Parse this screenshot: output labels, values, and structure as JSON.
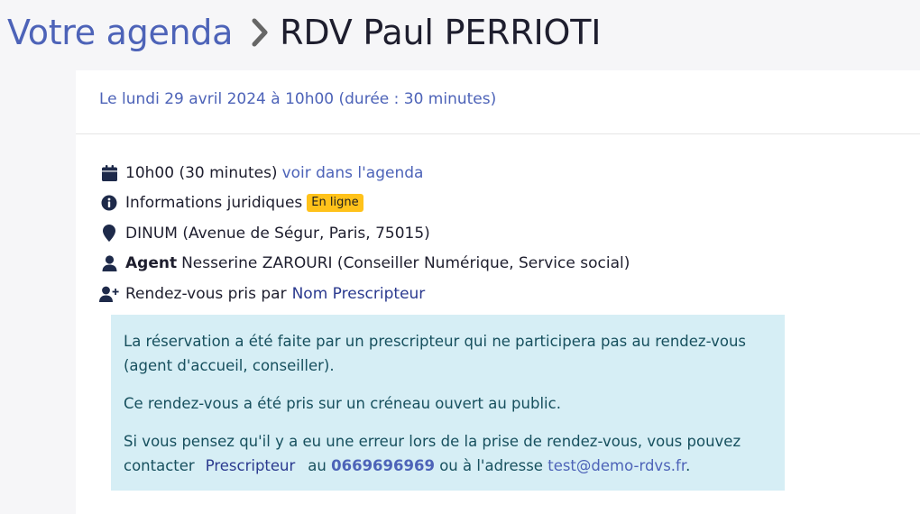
{
  "breadcrumb": {
    "parent_label": "Votre agenda",
    "current_label": "RDV Paul PERRIOTI"
  },
  "appointment": {
    "date_line": "Le lundi 29 avril 2024 à 10h00 (durée : 30 minutes)",
    "time_text": "10h00 (30 minutes)",
    "agenda_link": "voir dans l'agenda",
    "motif": "Informations juridiques",
    "location_badge": "En ligne",
    "place": "DINUM (Avenue de Ségur, Paris, 75015)",
    "agent_label": "Agent",
    "agent_value": "Nesserine ZAROURI (Conseiller Numérique, Service social)",
    "created_by_label": "Rendez-vous pris par",
    "created_by_link": "Nom Prescripteur"
  },
  "alert": {
    "line1": "La réservation a été faite par un prescripteur qui ne participera pas au rendez-vous",
    "line1b": "(agent d'accueil, conseiller).",
    "line2": "Ce rendez-vous a été pris sur un créneau ouvert au public.",
    "line3a": "Si vous pensez qu'il y a eu une erreur lors de la prise de rendez-vous, vous pouvez",
    "line3b_prefix": "contacter",
    "prescriber": "Prescripteur",
    "line3b_mid": "au",
    "phone": "0669696969",
    "line3b_mid2": "ou à l'adresse",
    "email": "test@demo-rdvs.fr",
    "line3b_end": "."
  },
  "colors": {
    "link": "#4d63b8",
    "badge": "#ffc21a",
    "alert_bg": "#d6eef5",
    "alert_text": "#17505e"
  },
  "icons": [
    "chevron-right-icon",
    "calendar-icon",
    "info-icon",
    "map-marker-icon",
    "user-icon",
    "user-plus-icon"
  ]
}
